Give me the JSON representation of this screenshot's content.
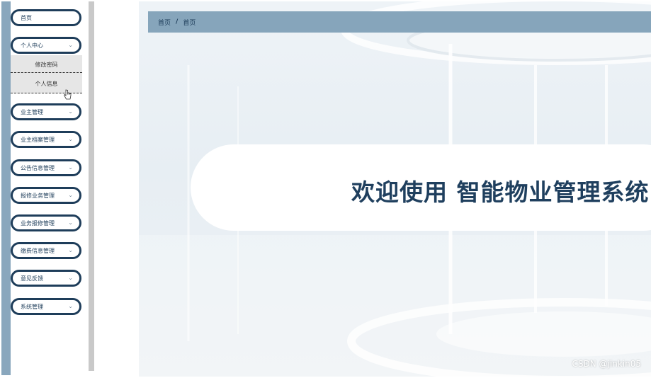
{
  "sidebar": {
    "items": [
      {
        "label": "首页"
      },
      {
        "label": "个人中心",
        "submenu": [
          "修改密码",
          "个人信息"
        ]
      },
      {
        "label": "业主管理"
      },
      {
        "label": "业主档案管理"
      },
      {
        "label": "公告信息管理"
      },
      {
        "label": "报修业务管理"
      },
      {
        "label": "业务报修管理"
      },
      {
        "label": "缴费信息管理"
      },
      {
        "label": "意见反馈"
      },
      {
        "label": "系统管理"
      }
    ],
    "chevron": "⌄"
  },
  "breadcrumb": {
    "root": "首页",
    "separator": "/",
    "current": "首页"
  },
  "welcome": {
    "text": "欢迎使用 智能物业管理系统"
  },
  "watermark": "CSDN @jinkin05",
  "colors": {
    "accent": "#1e3d5a",
    "bar": "#86a5bb",
    "strip": "#89a7bd"
  }
}
